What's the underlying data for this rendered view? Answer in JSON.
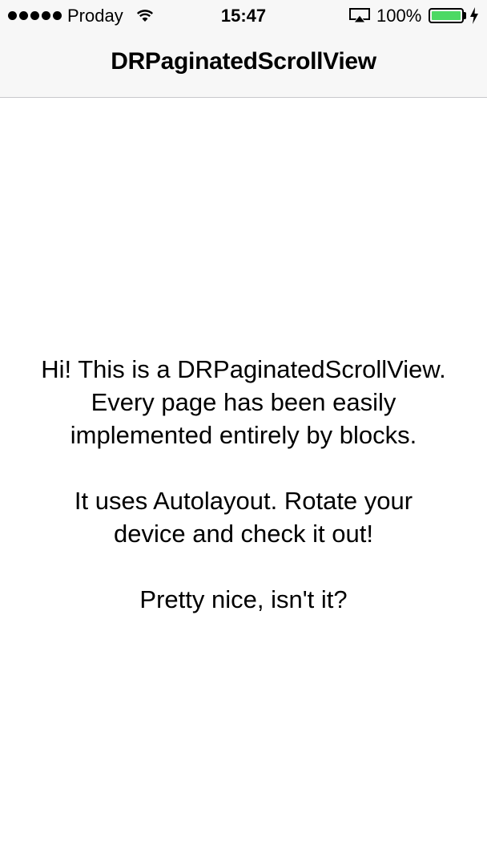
{
  "status_bar": {
    "carrier": "Proday",
    "time": "15:47",
    "battery_percent": "100%",
    "battery_level": 1.0,
    "signal_bars": 5,
    "icons": [
      "signal-dots-icon",
      "wifi-icon",
      "airplay-icon",
      "battery-icon",
      "charging-bolt-icon"
    ],
    "battery_color": "#4cd964"
  },
  "nav_bar": {
    "title": "DRPaginatedScrollView"
  },
  "content": {
    "paragraphs": [
      {
        "lines": [
          "Hi! This is a DRPaginatedScrollView.",
          "Every page has been easily",
          "implemented entirely by blocks."
        ]
      },
      {
        "lines": [
          "It uses Autolayout. Rotate your",
          "device and check it out!"
        ]
      },
      {
        "lines": [
          "Pretty nice, isn't it?"
        ]
      }
    ]
  }
}
